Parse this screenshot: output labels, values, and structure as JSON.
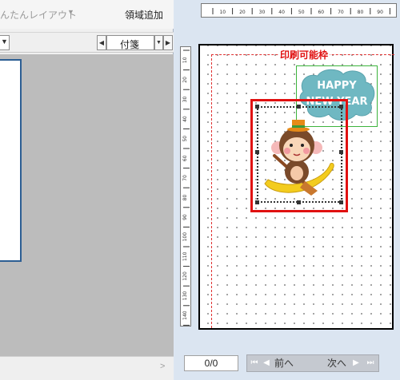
{
  "menu": {
    "easy_layout": "んたんレイアウト",
    "add_area": "領域追加"
  },
  "toolbar": {
    "sticky_dropdown_value": "付箋"
  },
  "canvas": {
    "print_area_label": "印刷可能枠",
    "top_ruler_labels": [
      "10",
      "20",
      "30",
      "40",
      "50",
      "60",
      "70",
      "80",
      "90"
    ],
    "side_ruler_labels": [
      "10",
      "20",
      "30",
      "40",
      "50",
      "60",
      "70",
      "80",
      "90",
      "100",
      "110",
      "120",
      "130",
      "140"
    ],
    "happy_text_line1": "HAPPY",
    "happy_text_line2": "NEW YEAR"
  },
  "navigation": {
    "page_counter": "0/0",
    "prev_label": "前へ",
    "next_label": "次へ"
  },
  "colors": {
    "print_frame": "#e03030",
    "selection_border": "#e01010",
    "happy_box_border": "#3cb43c",
    "page_thumb_border": "#2c5e93"
  }
}
